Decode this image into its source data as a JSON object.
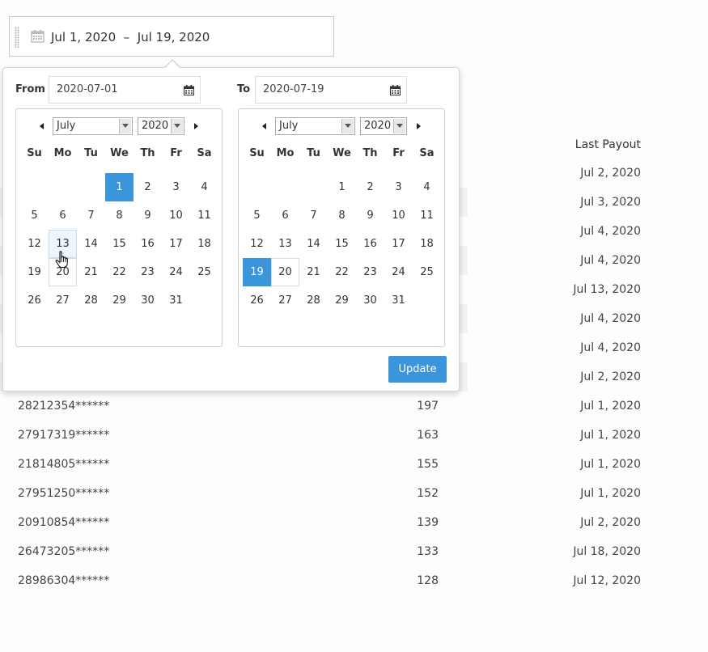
{
  "range": {
    "text": "Jul 1, 2020  –  Jul 19, 2020",
    "icon": "calendar-icon"
  },
  "popup": {
    "from": {
      "label": "From",
      "value": "2020-07-01",
      "icon": "calendar-icon",
      "month": "July",
      "year": "2020",
      "selected_day": "1",
      "hover_day": "13",
      "outline_day": "20"
    },
    "to": {
      "label": "To",
      "value": "2020-07-19",
      "icon": "calendar-icon",
      "month": "July",
      "year": "2020",
      "selected_day": "19",
      "outline_day": "20"
    },
    "weekdays": [
      "Su",
      "Mo",
      "Tu",
      "We",
      "Th",
      "Fr",
      "Sa"
    ],
    "weeks": [
      [
        "",
        "",
        "",
        "1",
        "2",
        "3",
        "4"
      ],
      [
        "5",
        "6",
        "7",
        "8",
        "9",
        "10",
        "11"
      ],
      [
        "12",
        "13",
        "14",
        "15",
        "16",
        "17",
        "18"
      ],
      [
        "19",
        "20",
        "21",
        "22",
        "23",
        "24",
        "25"
      ],
      [
        "26",
        "27",
        "28",
        "29",
        "30",
        "31",
        ""
      ]
    ],
    "update_label": "Update"
  },
  "table": {
    "header_payout": "Last Payout",
    "hidden_payouts": [
      "Jul 2, 2020",
      "Jul 3, 2020",
      "Jul 4, 2020",
      "Jul 4, 2020",
      "Jul 13, 2020",
      "Jul 4, 2020",
      "Jul 4, 2020",
      "Jul 2, 2020"
    ],
    "rows": [
      {
        "id": "28212354******",
        "count": "197",
        "payout": "Jul 1, 2020"
      },
      {
        "id": "27917319******",
        "count": "163",
        "payout": "Jul 1, 2020"
      },
      {
        "id": "21814805******",
        "count": "155",
        "payout": "Jul 1, 2020"
      },
      {
        "id": "27951250******",
        "count": "152",
        "payout": "Jul 1, 2020"
      },
      {
        "id": "20910854******",
        "count": "139",
        "payout": "Jul 2, 2020"
      },
      {
        "id": "26473205******",
        "count": "133",
        "payout": "Jul 18, 2020"
      },
      {
        "id": "28986304******",
        "count": "128",
        "payout": "Jul 12, 2020"
      }
    ]
  },
  "colors": {
    "accent": "#3a95db",
    "hover": "#eef5fb"
  }
}
